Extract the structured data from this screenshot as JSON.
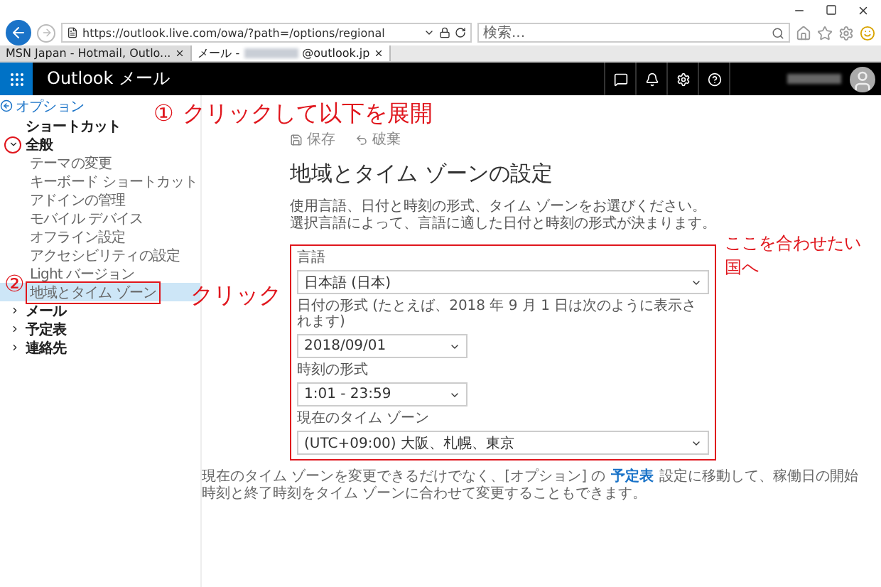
{
  "browser": {
    "url": "https://outlook.live.com/owa/?path=/options/regional",
    "search_placeholder": "検索...",
    "tabs": [
      {
        "title": "MSN Japan - Hotmail, Outlo...",
        "selected": false
      },
      {
        "title": "メール -",
        "title_end": "@outlook.jp",
        "selected": true
      }
    ]
  },
  "app_header": {
    "title": "Outlook メール"
  },
  "sidebar": {
    "back_link": "オプション",
    "items": [
      {
        "label": "ショートカット",
        "selected": false
      },
      {
        "label": "全般",
        "selected": false,
        "expanded": true,
        "children": [
          {
            "label": "テーマの変更",
            "selected": false
          },
          {
            "label": "キーボード ショートカット",
            "selected": false
          },
          {
            "label": "アドインの管理",
            "selected": false
          },
          {
            "label": "モバイル デバイス",
            "selected": false
          },
          {
            "label": "オフライン設定",
            "selected": false
          },
          {
            "label": "アクセシビリティの設定",
            "selected": false
          },
          {
            "label": "Light バージョン",
            "selected": false
          },
          {
            "label": "地域とタイム ゾーン",
            "selected": true
          }
        ]
      },
      {
        "label": "メール",
        "selected": false,
        "expanded": false
      },
      {
        "label": "予定表",
        "selected": false,
        "expanded": false
      },
      {
        "label": "連絡先",
        "selected": false,
        "expanded": false
      }
    ]
  },
  "toolbar": [
    {
      "kind": "save",
      "label": "保存"
    },
    {
      "kind": "discard",
      "label": "破棄"
    }
  ],
  "content": {
    "title": "地域とタイム ゾーンの設定",
    "description": [
      "使用言語、日付と時刻の形式、タイム ゾーンをお選びください。",
      "選択言語によって、言語に適した日付と時刻の形式が決まります。"
    ],
    "fields": [
      {
        "label": "言語",
        "value": "日本語 (日本)",
        "kind": "wide"
      },
      {
        "label": "日付の形式 (たとえば、2018 年 9 月 1 日は次のように表示されます)",
        "value": "2018/09/01",
        "kind": "narrow"
      },
      {
        "label": "時刻の形式",
        "value": "1:01 - 23:59",
        "kind": "narrow"
      },
      {
        "label": "現在のタイム ゾーン",
        "value": "(UTC+09:00) 大阪、札幌、東京",
        "kind": "wide"
      }
    ],
    "footer": {
      "before": "現在のタイム ゾーンを変更できるだけでなく、[オプション] の",
      "link": "予定表",
      "after": "設定に移動して、稼働日の開始時刻と終了時刻をタイム ゾーンに合わせて変更することもできます。"
    }
  },
  "annotations": {
    "step1": {
      "number": "①",
      "text": "クリックして以下を展開"
    },
    "step2": {
      "number": "②",
      "text": "クリック"
    },
    "note": [
      "ここを合わせたい",
      "国へ"
    ]
  }
}
